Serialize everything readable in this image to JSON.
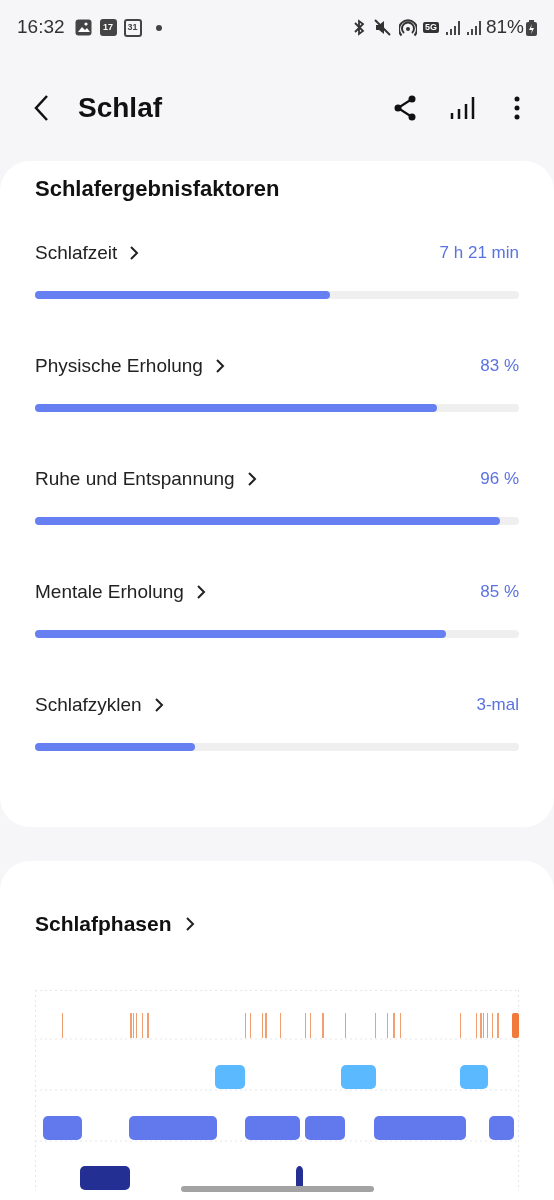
{
  "status_bar": {
    "time": "16:32",
    "calendar_day": "17",
    "calendar_date": "31",
    "network": "5G",
    "battery": "81%"
  },
  "header": {
    "title": "Schlaf"
  },
  "factors": {
    "title": "Schlafergebnisfaktoren",
    "items": [
      {
        "label": "Schlafzeit",
        "value": "7 h 21 min",
        "level": 0.61
      },
      {
        "label": "Physische Erholung",
        "value": "83 %",
        "level": 0.83
      },
      {
        "label": "Ruhe und Entspannung",
        "value": "96 %",
        "level": 0.96
      },
      {
        "label": "Mentale Erholung",
        "value": "85 %",
        "level": 0.85
      },
      {
        "label": "Schlafzyklen",
        "value": "3-mal",
        "level": 0.33
      }
    ]
  },
  "phases": {
    "title": "Schlafphasen"
  }
}
